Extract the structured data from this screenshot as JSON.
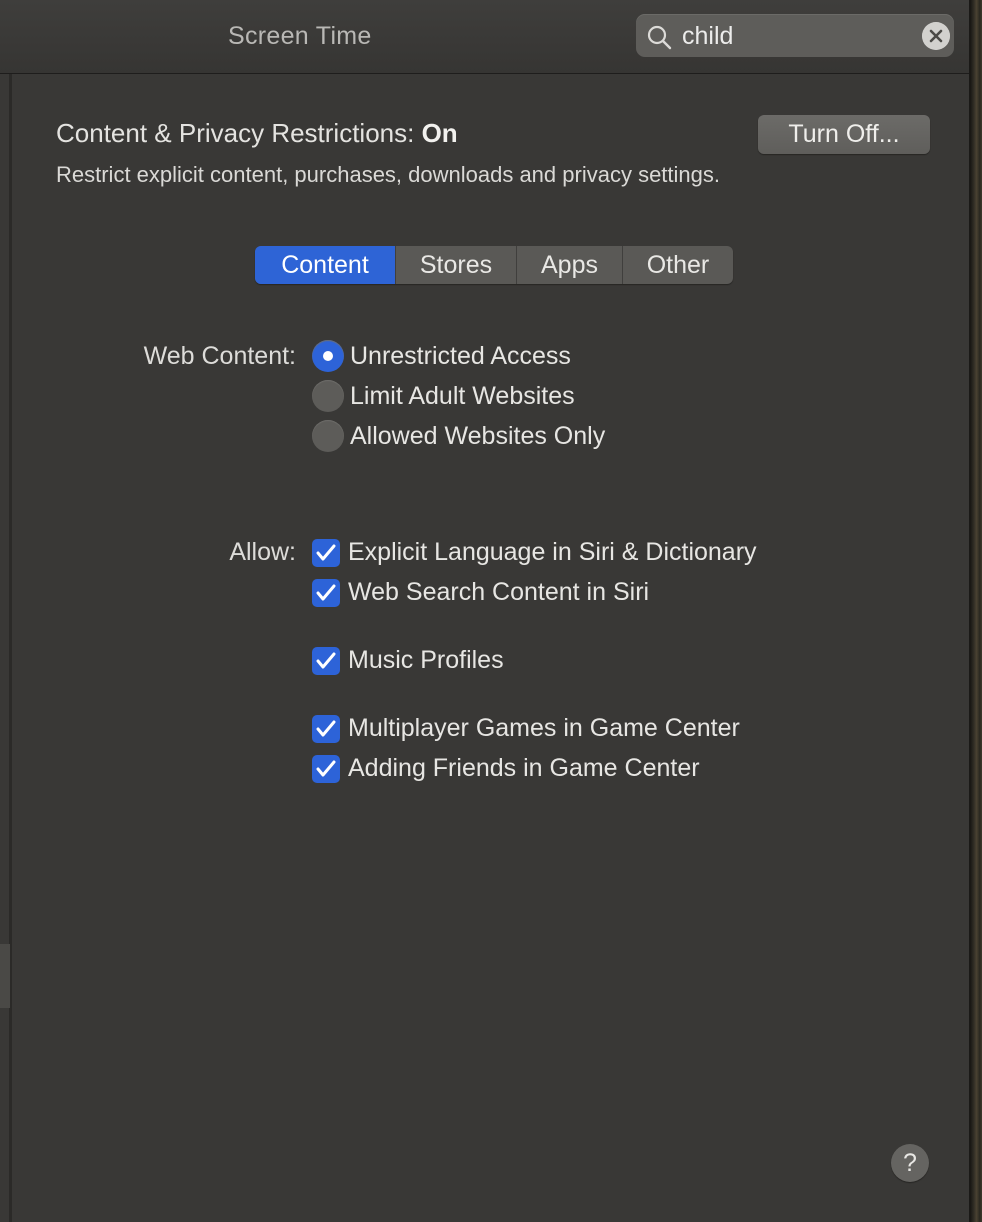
{
  "window": {
    "title": "Screen Time"
  },
  "search": {
    "value": "child"
  },
  "restrictions": {
    "heading_prefix": "Content & Privacy Restrictions: ",
    "heading_state": "On",
    "description": "Restrict explicit content, purchases, downloads and privacy settings.",
    "turn_off_label": "Turn Off..."
  },
  "tabs": [
    {
      "label": "Content",
      "selected": true
    },
    {
      "label": "Stores",
      "selected": false
    },
    {
      "label": "Apps",
      "selected": false
    },
    {
      "label": "Other",
      "selected": false
    }
  ],
  "web_content": {
    "label": "Web Content:",
    "options": [
      {
        "label": "Unrestricted Access",
        "selected": true
      },
      {
        "label": "Limit Adult Websites",
        "selected": false
      },
      {
        "label": "Allowed Websites Only",
        "selected": false
      }
    ]
  },
  "allow": {
    "label": "Allow:",
    "items": [
      {
        "label": "Explicit Language in Siri & Dictionary",
        "checked": true
      },
      {
        "label": "Web Search Content in Siri",
        "checked": true
      },
      {
        "label": "Music Profiles",
        "checked": true
      },
      {
        "label": "Multiplayer Games in Game Center",
        "checked": true
      },
      {
        "label": "Adding Friends in Game Center",
        "checked": true
      }
    ]
  },
  "help": {
    "label": "?"
  },
  "colors": {
    "accent": "#2d63d8",
    "background": "#393836",
    "text": "#e7e6e3"
  }
}
